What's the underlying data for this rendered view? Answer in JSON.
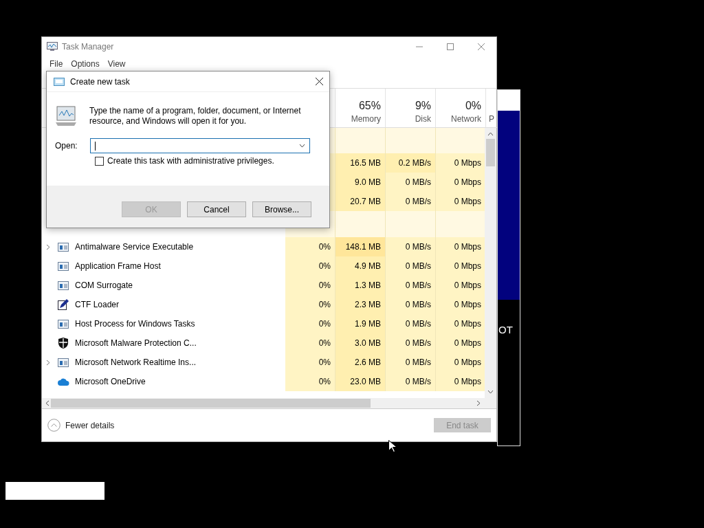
{
  "task_manager": {
    "title": "Task Manager",
    "menu": [
      "File",
      "Options",
      "View"
    ],
    "columns": [
      {
        "percent": "65%",
        "label": "Memory"
      },
      {
        "percent": "9%",
        "label": "Disk"
      },
      {
        "percent": "0%",
        "label": "Network"
      },
      {
        "label": "P"
      }
    ],
    "app_rows": [
      {
        "memory": "16.5 MB",
        "disk": "0.2 MB/s",
        "network": "0 Mbps"
      },
      {
        "memory": "9.0 MB",
        "disk": "0 MB/s",
        "network": "0 Mbps"
      },
      {
        "memory": "20.7 MB",
        "disk": "0 MB/s",
        "network": "0 Mbps"
      }
    ],
    "background_rows": [
      {
        "name": "Antimalware Service Executable",
        "kind": "app",
        "expandable": true,
        "cpu": "0%",
        "memory": "148.1 MB",
        "disk": "0 MB/s",
        "network": "0 Mbps"
      },
      {
        "name": "Application Frame Host",
        "kind": "app",
        "expandable": false,
        "cpu": "0%",
        "memory": "4.9 MB",
        "disk": "0 MB/s",
        "network": "0 Mbps"
      },
      {
        "name": "COM Surrogate",
        "kind": "app",
        "expandable": false,
        "cpu": "0%",
        "memory": "1.3 MB",
        "disk": "0 MB/s",
        "network": "0 Mbps"
      },
      {
        "name": "CTF Loader",
        "kind": "pen",
        "expandable": false,
        "cpu": "0%",
        "memory": "2.3 MB",
        "disk": "0 MB/s",
        "network": "0 Mbps"
      },
      {
        "name": "Host Process for Windows Tasks",
        "kind": "app",
        "expandable": false,
        "cpu": "0%",
        "memory": "1.9 MB",
        "disk": "0 MB/s",
        "network": "0 Mbps"
      },
      {
        "name": "Microsoft Malware Protection C...",
        "kind": "shield",
        "expandable": false,
        "cpu": "0%",
        "memory": "3.0 MB",
        "disk": "0 MB/s",
        "network": "0 Mbps"
      },
      {
        "name": "Microsoft Network Realtime Ins...",
        "kind": "app",
        "expandable": true,
        "cpu": "0%",
        "memory": "2.6 MB",
        "disk": "0 MB/s",
        "network": "0 Mbps"
      },
      {
        "name": "Microsoft OneDrive",
        "kind": "cloud",
        "expandable": false,
        "cpu": "0%",
        "memory": "23.0 MB",
        "disk": "0 MB/s",
        "network": "0 Mbps"
      }
    ],
    "footer": {
      "details": "Fewer details",
      "end_task": {
        "label": "End task",
        "disabled": true
      }
    }
  },
  "dialog": {
    "title": "Create new task",
    "message": "Type the name of a program, folder, document, or Internet resource, and Windows will open it for you.",
    "open_label": "Open:",
    "admin": {
      "label": "Create this task with administrative privileges.",
      "checked": false
    },
    "buttons": [
      {
        "label": "OK",
        "disabled": true
      },
      {
        "label": "Cancel",
        "disabled": false
      },
      {
        "label": "Browse...",
        "disabled": false
      }
    ]
  },
  "background_window": {
    "text": "OT"
  }
}
